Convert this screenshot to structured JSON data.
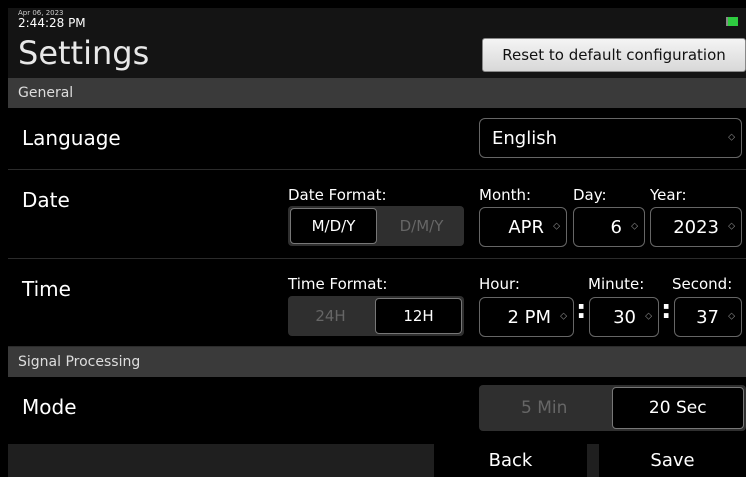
{
  "status": {
    "date": "Apr 06, 2023",
    "time": "2:44:28 PM"
  },
  "page_title": "Settings",
  "reset_label": "Reset to default configuration",
  "sections": {
    "general": "General",
    "signal": "Signal Processing"
  },
  "language": {
    "label": "Language",
    "value": "English"
  },
  "date": {
    "label": "Date",
    "format_label": "Date Format:",
    "formats": [
      "M/D/Y",
      "D/M/Y"
    ],
    "selected_format": "M/D/Y",
    "month_label": "Month:",
    "month": "APR",
    "day_label": "Day:",
    "day": "6",
    "year_label": "Year:",
    "year": "2023"
  },
  "time": {
    "label": "Time",
    "format_label": "Time Format:",
    "formats": [
      "24H",
      "12H"
    ],
    "selected_format": "12H",
    "hour_label": "Hour:",
    "hour": "2 PM",
    "minute_label": "Minute:",
    "minute": "30",
    "second_label": "Second:",
    "second": "37",
    "separator": ":"
  },
  "mode": {
    "label": "Mode",
    "options": [
      "5 Min",
      "20 Sec"
    ],
    "selected": "20 Sec"
  },
  "footer": {
    "back": "Back",
    "save": "Save"
  },
  "colors": {
    "battery": "#2ecc40",
    "section_bg": "#3a3a3a"
  }
}
